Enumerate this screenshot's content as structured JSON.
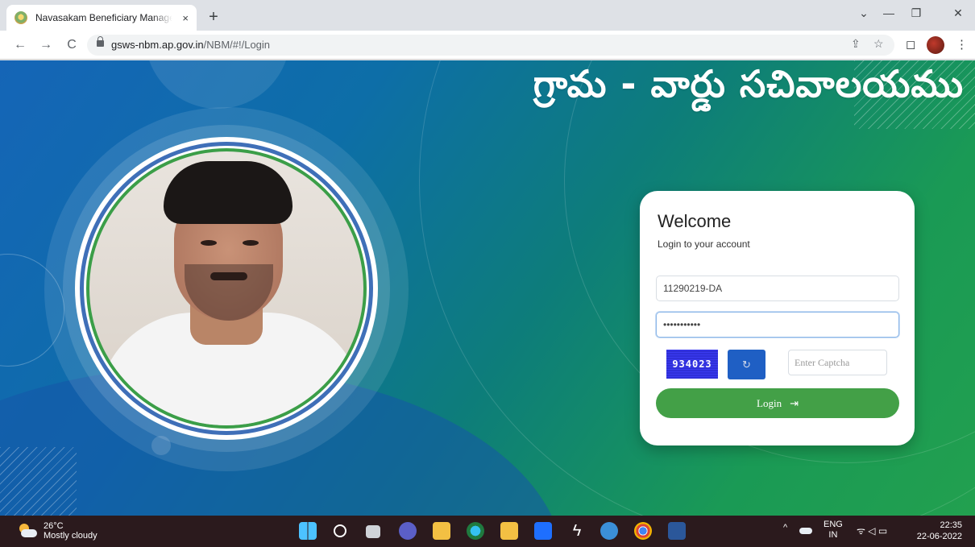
{
  "browser": {
    "tab_title": "Navasakam Beneficiary Management",
    "tab_close": "×",
    "new_tab": "+",
    "url_host": "gsws-nbm.ap.gov.in",
    "url_path": "/NBM/#!/Login",
    "window_controls": {
      "minimize": "—",
      "restore": "❐",
      "close": "✕",
      "tabsearch": "⌄"
    },
    "nav": {
      "back": "←",
      "forward": "→",
      "reload": "C"
    },
    "toolbar_icons": {
      "share": "⇪",
      "bookmark": "☆",
      "sidepanel": "◻",
      "menu": "⋮"
    }
  },
  "page": {
    "title_telugu": "గ్రామ - వార్డు సచివాలయము"
  },
  "login": {
    "heading": "Welcome",
    "subtitle": "Login to your account",
    "username_value": "11290219-DA",
    "password_value": "•••••••••••",
    "captcha_text": "934023",
    "captcha_placeholder": "Enter Captcha",
    "refresh_glyph": "↻",
    "login_label": "Login",
    "login_icon": "⇥"
  },
  "taskbar": {
    "temperature": "26°C",
    "weather": "Mostly cloudy",
    "language_1": "ENG",
    "language_2": "IN",
    "time": "22:35",
    "date": "22-06-2022",
    "tray_chevron": "^",
    "tray_icons": "ᯤ ◁ ▭"
  },
  "colors": {
    "login_button": "#43a047",
    "refresh_button": "#1f5fc4",
    "captcha_bg": "#3333e0",
    "taskbar": "#2b1a1d"
  }
}
